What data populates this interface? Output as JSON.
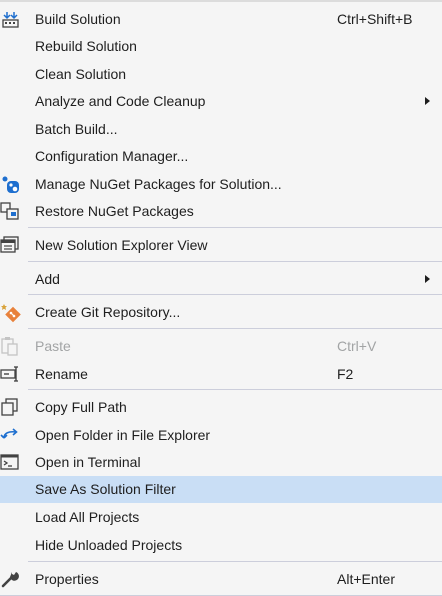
{
  "menu": {
    "items": [
      {
        "label": "Build Solution",
        "shortcut": "Ctrl+Shift+B",
        "icon": "build-solution-icon"
      },
      {
        "label": "Rebuild Solution"
      },
      {
        "label": "Clean Solution"
      },
      {
        "label": "Analyze and Code Cleanup",
        "submenu": true
      },
      {
        "label": "Batch Build..."
      },
      {
        "label": "Configuration Manager..."
      },
      {
        "label": "Manage NuGet Packages for Solution...",
        "icon": "nuget-icon"
      },
      {
        "label": "Restore NuGet Packages",
        "icon": "restore-packages-icon"
      },
      {
        "label": "New Solution Explorer View",
        "icon": "new-explorer-view-icon"
      },
      {
        "label": "Add",
        "submenu": true
      },
      {
        "label": "Create Git Repository...",
        "icon": "git-icon"
      },
      {
        "label": "Paste",
        "shortcut": "Ctrl+V",
        "disabled": true,
        "icon": "paste-icon"
      },
      {
        "label": "Rename",
        "shortcut": "F2",
        "icon": "rename-icon"
      },
      {
        "label": "Copy Full Path",
        "icon": "copy-icon"
      },
      {
        "label": "Open Folder in File Explorer",
        "icon": "open-folder-arrow-icon"
      },
      {
        "label": "Open in Terminal",
        "icon": "terminal-icon"
      },
      {
        "label": "Save As Solution Filter",
        "highlighted": true
      },
      {
        "label": "Load All Projects"
      },
      {
        "label": "Hide Unloaded Projects"
      },
      {
        "label": "Properties",
        "shortcut": "Alt+Enter",
        "icon": "wrench-icon"
      }
    ]
  },
  "colors": {
    "background": "#f5f5f5",
    "highlight": "#c9def5",
    "separator": "#cccedb",
    "disabled_text": "#a2a4a5",
    "text": "#1e1e1e",
    "icon_blue": "#1e6fcf"
  }
}
